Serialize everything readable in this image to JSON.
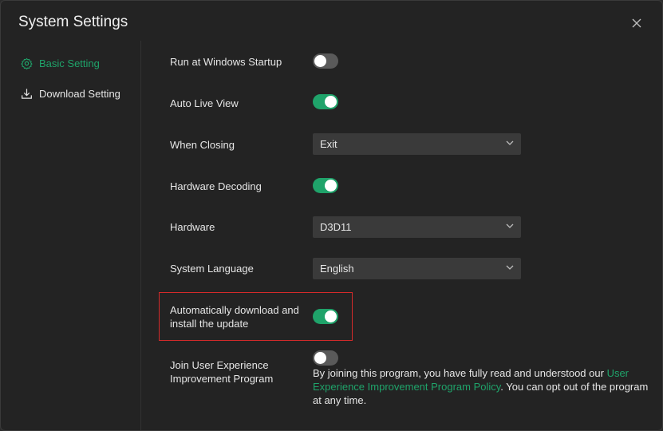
{
  "window": {
    "title": "System Settings"
  },
  "sidebar": {
    "items": [
      {
        "label": "Basic Setting",
        "icon": "gear-icon",
        "active": true
      },
      {
        "label": "Download Setting",
        "icon": "download-icon",
        "active": false
      }
    ]
  },
  "settings": {
    "run_at_startup": {
      "label": "Run at Windows Startup",
      "enabled": false
    },
    "auto_live_view": {
      "label": "Auto Live View",
      "enabled": true
    },
    "when_closing": {
      "label": "When Closing",
      "value": "Exit"
    },
    "hardware_decoding": {
      "label": "Hardware Decoding",
      "enabled": true
    },
    "hardware": {
      "label": "Hardware",
      "value": "D3D11"
    },
    "system_language": {
      "label": "System Language",
      "value": "English"
    },
    "auto_update": {
      "label_line1": "Automatically download and",
      "label_line2": "install the update",
      "enabled": true
    },
    "ux_program": {
      "label_line1": "Join User Experience",
      "label_line2": "Improvement Program",
      "enabled": false,
      "desc_before": "By joining this program, you have fully read and understood our ",
      "desc_link": "User Experience Improvement Program Policy",
      "desc_after": ". You can opt out of the program at any time."
    }
  },
  "colors": {
    "accent": "#1fa36a",
    "highlight_border": "#d42a2a",
    "background": "#232323"
  }
}
